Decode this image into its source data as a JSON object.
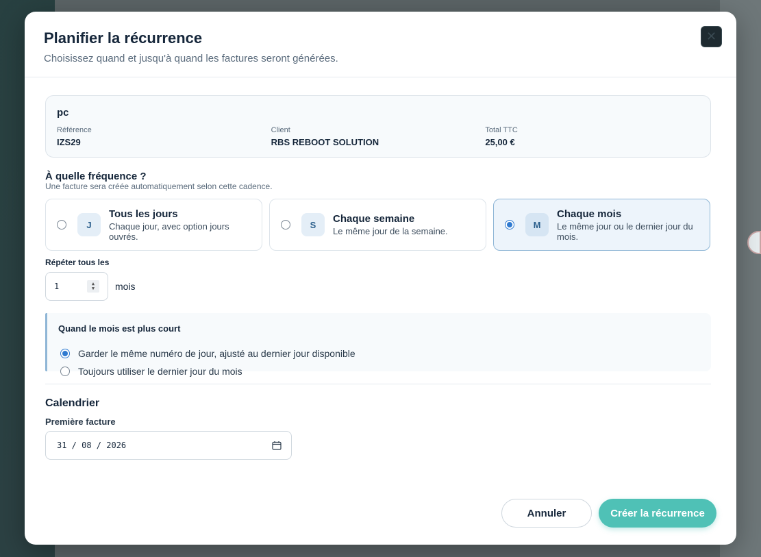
{
  "modal": {
    "title": "Planifier la récurrence",
    "subtitle": "Choisissez quand et jusqu'à quand les factures seront générées.",
    "close_icon": "close-icon"
  },
  "summary": {
    "name": "pc",
    "reference_label": "Référence",
    "reference_value": "IZS29",
    "client_label": "Client",
    "client_value": "RBS REBOOT SOLUTION",
    "total_label": "Total TTC",
    "total_value": "25,00 €"
  },
  "frequency": {
    "title": "À quelle fréquence ?",
    "subtitle": "Une facture sera créée automatiquement selon cette cadence.",
    "options": [
      {
        "badge": "J",
        "name": "Tous les jours",
        "desc": "Chaque jour, avec option jours ouvrés.",
        "selected": false
      },
      {
        "badge": "S",
        "name": "Chaque semaine",
        "desc": "Le même jour de la semaine.",
        "selected": false
      },
      {
        "badge": "M",
        "name": "Chaque mois",
        "desc": "Le même jour ou le dernier jour du mois.",
        "selected": true
      }
    ]
  },
  "repeat": {
    "label": "Répéter tous les",
    "value": "1",
    "unit": "mois"
  },
  "short_month": {
    "title": "Quand le mois est plus court",
    "options": [
      {
        "label": "Garder le même numéro de jour, ajusté au dernier jour disponible",
        "checked": true
      },
      {
        "label": "Toujours utiliser le dernier jour du mois",
        "checked": false
      }
    ]
  },
  "calendar": {
    "title": "Calendrier",
    "first_invoice_label": "Première facture",
    "first_invoice_value": "31 / 08 / 2026"
  },
  "actions": {
    "cancel_label": "Annuler",
    "create_label": "Créer la récurrence"
  },
  "colors": {
    "accent": "#4fc1b6",
    "selected_border": "#8fb6d6",
    "radio": "#2f7ad0"
  }
}
